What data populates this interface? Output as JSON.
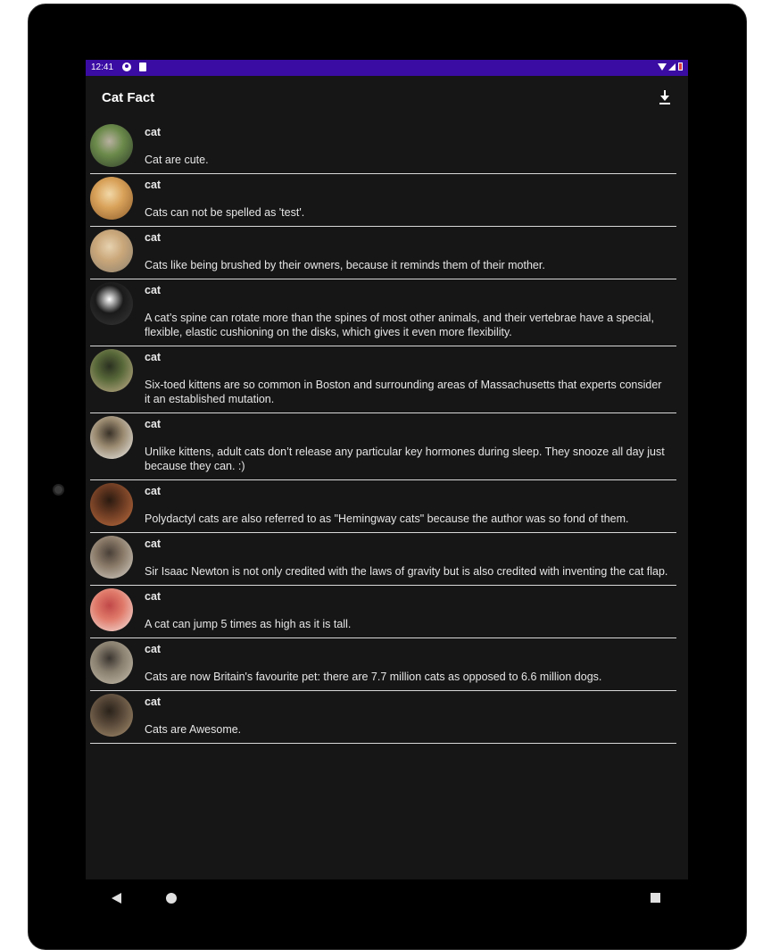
{
  "status_bar": {
    "time": "12:41",
    "background": "#3a0ca3"
  },
  "app_bar": {
    "title": "Cat Fact",
    "action_icon": "download-icon"
  },
  "items": [
    {
      "title": "cat",
      "body": "Cat are cute.",
      "avatar_colors": [
        "#6b8a4a",
        "#2e3b2a",
        "#b8b0a0"
      ]
    },
    {
      "title": "cat",
      "body": "Cats can not be spelled as 'test'.",
      "avatar_colors": [
        "#d9a25a",
        "#8a5a2a",
        "#f1d8a8"
      ]
    },
    {
      "title": "cat",
      "body": "Cats like being brushed by their owners, because it reminds them of their mother.",
      "avatar_colors": [
        "#caa77a",
        "#8a8070",
        "#e6d2b0"
      ]
    },
    {
      "title": "cat",
      "body": "A cat’s spine can rotate more than the spines of most other animals, and their vertebrae have a special, flexible, elastic cushioning on the disks, which gives it even more flexibility.",
      "avatar_colors": [
        "#1a1a1a",
        "#3a3a3a",
        "#ffffff"
      ]
    },
    {
      "title": "cat",
      "body": "Six-toed kittens are so common in Boston and surrounding areas of Massachusetts that experts consider it an established mutation.",
      "avatar_colors": [
        "#5a6a3a",
        "#c8b090",
        "#2a3020"
      ]
    },
    {
      "title": "cat",
      "body": "Unlike kittens, adult cats don’t release any particular key hormones during sleep. They snooze all day just because they can. :)",
      "avatar_colors": [
        "#9a8a70",
        "#f0f0f0",
        "#3a3228"
      ]
    },
    {
      "title": "cat",
      "body": "Polydactyl cats are also referred to as \"Hemingway cats\" because the author was so fond of them.",
      "avatar_colors": [
        "#6a3a22",
        "#c07040",
        "#2a1a10"
      ]
    },
    {
      "title": "cat",
      "body": "Sir Isaac Newton is not only credited with the laws of gravity but is also credited with inventing the cat flap.",
      "avatar_colors": [
        "#8a7a68",
        "#d8d4cc",
        "#4a4038"
      ]
    },
    {
      "title": "cat",
      "body": "A cat can jump 5 times as high as it is tall.",
      "avatar_colors": [
        "#e07a6a",
        "#f4e8e4",
        "#c04848"
      ]
    },
    {
      "title": "cat",
      "body": "Cats are now Britain's favourite pet: there are 7.7 million cats as opposed to 6.6 million dogs.",
      "avatar_colors": [
        "#8a8070",
        "#c8c0b0",
        "#3a3530"
      ]
    },
    {
      "title": "cat",
      "body": "Cats are Awesome.",
      "avatar_colors": [
        "#5a4a3a",
        "#a89070",
        "#2a221a"
      ]
    }
  ],
  "nav": {
    "back_icon": "back-triangle-icon",
    "home_icon": "home-circle-icon",
    "recents_icon": "recents-square-icon"
  }
}
